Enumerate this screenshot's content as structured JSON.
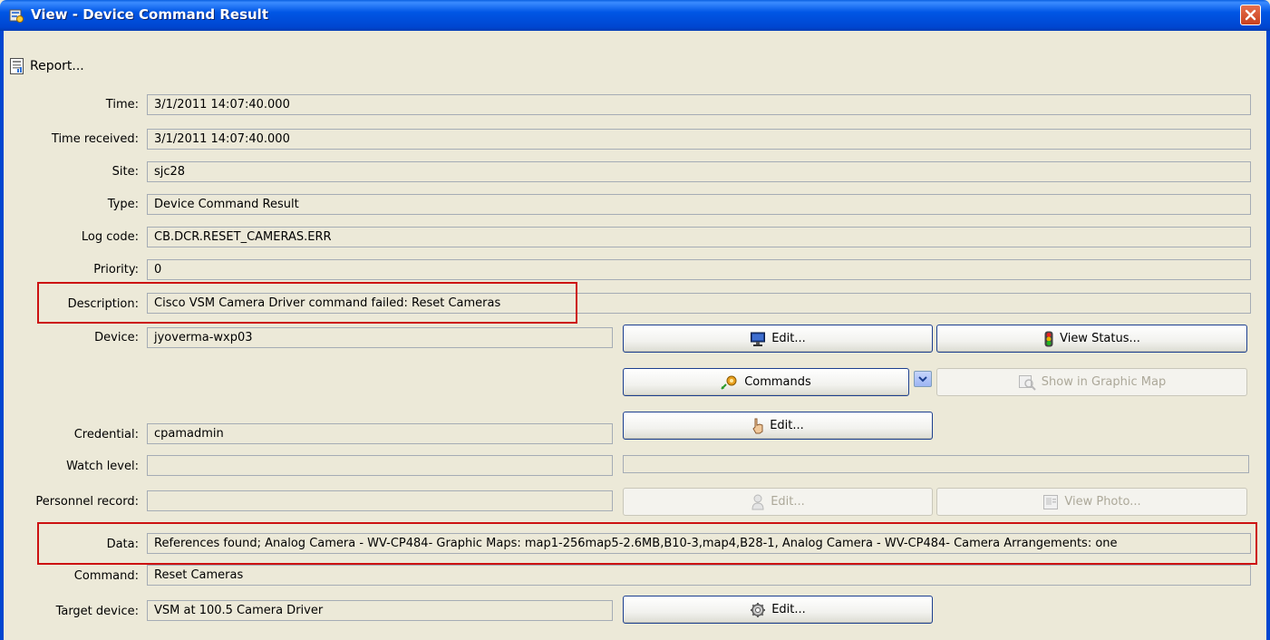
{
  "window": {
    "title": "View - Device Command Result",
    "icon": "view-window-icon"
  },
  "toolbar": {
    "report_label": "Report..."
  },
  "form": {
    "time": {
      "label": "Time:",
      "value": "3/1/2011 14:07:40.000"
    },
    "time_received": {
      "label": "Time received:",
      "value": "3/1/2011 14:07:40.000"
    },
    "site": {
      "label": "Site:",
      "value": "sjc28"
    },
    "type": {
      "label": "Type:",
      "value": "Device Command Result"
    },
    "log_code": {
      "label": "Log code:",
      "value": "CB.DCR.RESET_CAMERAS.ERR"
    },
    "priority": {
      "label": "Priority:",
      "value": "0"
    },
    "description": {
      "label": "Description:",
      "value": "Cisco VSM Camera Driver command failed: Reset Cameras"
    },
    "device": {
      "label": "Device:",
      "value": "jyoverma-wxp03"
    },
    "credential": {
      "label": "Credential:",
      "value": "cpamadmin"
    },
    "watch_level": {
      "label": "Watch level:",
      "value": ""
    },
    "personnel_record": {
      "label": "Personnel record:",
      "value": ""
    },
    "data": {
      "label": "Data:",
      "value": "References found; Analog Camera - WV-CP484- Graphic Maps: map1-256map5-2.6MB,B10-3,map4,B28-1, Analog Camera - WV-CP484- Camera Arrangements: one"
    },
    "command": {
      "label": "Command:",
      "value": "Reset Cameras"
    },
    "target_device": {
      "label": "Target device:",
      "value": "VSM  at 100.5 Camera Driver"
    }
  },
  "buttons": {
    "device_edit": "Edit...",
    "view_status": "View Status...",
    "commands": "Commands",
    "show_in_graphic_map": "Show in Graphic Map",
    "credential_edit": "Edit...",
    "personnel_edit": "Edit...",
    "view_photo": "View Photo...",
    "target_edit": "Edit..."
  },
  "colors": {
    "titlebar": "#0054e3",
    "window_bg": "#ece9d8",
    "highlight": "#cc1111"
  }
}
